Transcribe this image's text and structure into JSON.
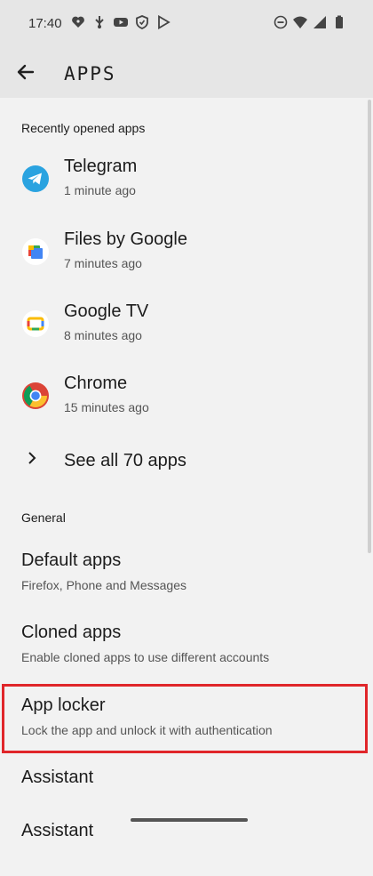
{
  "status_bar": {
    "time": "17:40",
    "left_icons": [
      "location-heart-icon",
      "usb-debug-icon",
      "youtube-icon",
      "shield-icon",
      "play-icon"
    ],
    "right_icons": [
      "dnd-icon",
      "wifi-icon",
      "signal-icon",
      "battery-icon"
    ]
  },
  "app_bar": {
    "title": "APPS"
  },
  "recent": {
    "header": "Recently opened apps",
    "apps": [
      {
        "name": "Telegram",
        "time": "1 minute ago"
      },
      {
        "name": "Files by Google",
        "time": "7 minutes ago"
      },
      {
        "name": "Google TV",
        "time": "8 minutes ago"
      },
      {
        "name": "Chrome",
        "time": "15 minutes ago"
      }
    ],
    "see_all": "See all 70 apps"
  },
  "general": {
    "header": "General",
    "items": [
      {
        "title": "Default apps",
        "subtitle": "Firefox, Phone and Messages"
      },
      {
        "title": "Cloned apps",
        "subtitle": "Enable cloned apps to use different accounts"
      },
      {
        "title": "App locker",
        "subtitle": "Lock the app and unlock it with authentication"
      },
      {
        "title": "Assistant",
        "subtitle": ""
      },
      {
        "title": "Assistant",
        "subtitle": ""
      }
    ]
  },
  "colors": {
    "highlight": "#e0262a",
    "telegram": "#2aa3e0"
  }
}
